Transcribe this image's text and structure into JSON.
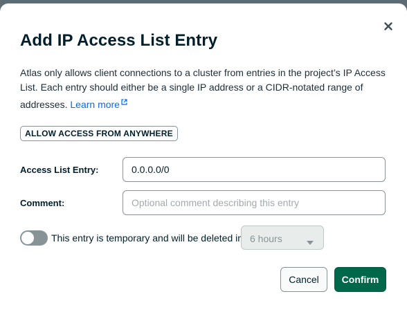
{
  "dialog": {
    "title": "Add IP Access List Entry",
    "description": "Atlas only allows client connections to a cluster from entries in the project’s IP Access List. Each entry should either be a single IP address or a CIDR-notated range of addresses.",
    "learn_more": "Learn more",
    "close_icon": "close-icon"
  },
  "allow_anywhere_label": "ALLOW ACCESS FROM ANYWHERE",
  "fields": {
    "entry_label": "Access List Entry:",
    "entry_value": "0.0.0.0/0",
    "comment_label": "Comment:",
    "comment_placeholder": "Optional comment describing this entry"
  },
  "temporary": {
    "enabled": false,
    "text": "This entry is temporary and will be deleted in",
    "duration_value": "6 hours"
  },
  "actions": {
    "cancel_label": "Cancel",
    "confirm_label": "Confirm"
  },
  "colors": {
    "primary": "#00684a",
    "link": "#016bf8",
    "text": "#001e2b"
  }
}
